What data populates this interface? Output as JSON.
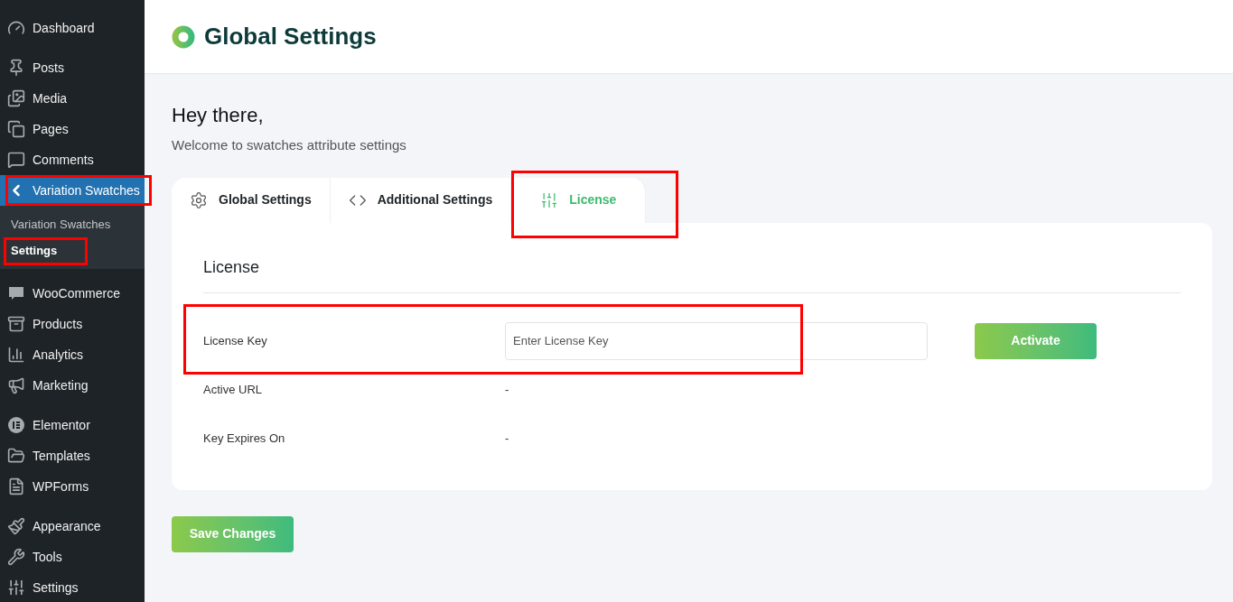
{
  "sidebar": {
    "groups": [
      {
        "items": [
          {
            "label": "Dashboard",
            "selected": false,
            "highlighted": false
          }
        ]
      },
      {
        "items": [
          {
            "label": "Posts",
            "selected": false,
            "highlighted": false
          },
          {
            "label": "Media",
            "selected": false,
            "highlighted": false
          },
          {
            "label": "Pages",
            "selected": false,
            "highlighted": false
          },
          {
            "label": "Comments",
            "selected": false,
            "highlighted": false
          },
          {
            "label": "Variation Swatches",
            "selected": true,
            "highlighted": true,
            "children": [
              {
                "label": "Variation Swatches",
                "selected": false,
                "highlighted": false
              },
              {
                "label": "Settings",
                "selected": true,
                "highlighted": true
              }
            ]
          }
        ]
      },
      {
        "items": [
          {
            "label": "WooCommerce",
            "selected": false,
            "highlighted": false
          },
          {
            "label": "Products",
            "selected": false,
            "highlighted": false
          },
          {
            "label": "Analytics",
            "selected": false,
            "highlighted": false
          },
          {
            "label": "Marketing",
            "selected": false,
            "highlighted": false
          }
        ]
      },
      {
        "items": [
          {
            "label": "Elementor",
            "selected": false,
            "highlighted": false
          },
          {
            "label": "Templates",
            "selected": false,
            "highlighted": false
          },
          {
            "label": "WPForms",
            "selected": false,
            "highlighted": false
          }
        ]
      },
      {
        "items": [
          {
            "label": "Appearance",
            "selected": false,
            "highlighted": false
          },
          {
            "label": "Tools",
            "selected": false,
            "highlighted": false
          },
          {
            "label": "Settings",
            "selected": false,
            "highlighted": false
          }
        ]
      }
    ]
  },
  "header": {
    "title": "Global Settings"
  },
  "greeting": {
    "title": "Hey there,",
    "subtitle": "Welcome to swatches attribute settings"
  },
  "tabs": [
    {
      "label": "Global Settings",
      "selected": false,
      "highlighted": false
    },
    {
      "label": "Additional Settings",
      "selected": false,
      "highlighted": false
    },
    {
      "label": "License",
      "selected": true,
      "highlighted": true
    }
  ],
  "card": {
    "title": "License",
    "rows": [
      {
        "kind": "input",
        "label": "License Key",
        "placeholder": "Enter License Key",
        "button": "Activate",
        "highlighted": true
      },
      {
        "kind": "text",
        "label": "Active URL",
        "value": "-",
        "highlighted": false
      },
      {
        "kind": "text",
        "label": "Key Expires On",
        "value": "-",
        "highlighted": false
      }
    ]
  },
  "save_button": "Save Changes"
}
